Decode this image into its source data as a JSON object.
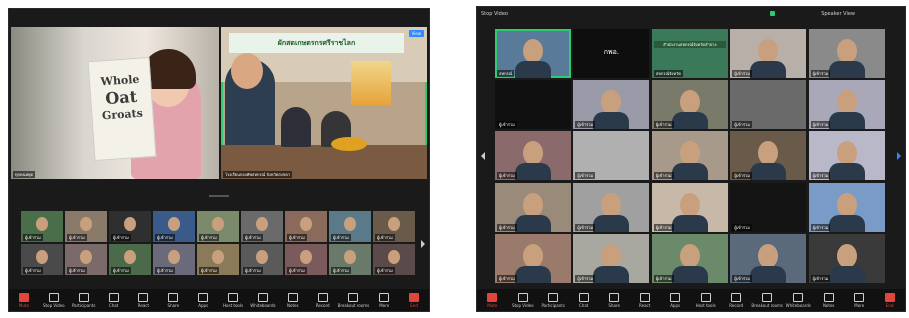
{
  "left_window": {
    "bag_text": [
      "Whole",
      "Oat",
      "Groats"
    ],
    "banner_text": "ผักสดเกษตรกรศรีราชไลก",
    "view_label": "View",
    "main_tiles": [
      {
        "name": "ทุกคนหยุด"
      },
      {
        "name": "โรงเรียนกองทัพสหกรณ์ จังหวัดสงขลา"
      }
    ],
    "thumb_names": [
      "ผู้เข้าร่วม",
      "ผู้เข้าร่วม",
      "ผู้เข้าร่วม",
      "ผู้เข้าร่วม",
      "ผู้เข้าร่วม",
      "ผู้เข้าร่วม",
      "ผู้เข้าร่วม",
      "ผู้เข้าร่วม",
      "ผู้เข้าร่วม",
      "ผู้เข้าร่วม",
      "ผู้เข้าร่วม",
      "ผู้เข้าร่วม",
      "ผู้เข้าร่วม",
      "ผู้เข้าร่วม",
      "ผู้เข้าร่วม",
      "ผู้เข้าร่วม",
      "ผู้เข้าร่วม",
      "ผู้เข้าร่วม"
    ],
    "toolbar": [
      "Mute",
      "Stop Video",
      "Participants",
      "Chat",
      "React",
      "Share",
      "Apps",
      "Host tools",
      "Whiteboards",
      "Notes",
      "Record",
      "Breakout rooms",
      "More",
      "End"
    ]
  },
  "right_window": {
    "title": "Stop Video",
    "top_right": "Speaker View",
    "center_tile_text": "กพอ.",
    "banner_text": "สำนักงานสหกรณ์จังหวัดลำปาง",
    "tile_names": [
      "สหกรณ์",
      "",
      "สหกรณ์จังหวัด",
      "ผู้เข้าร่วม",
      "ผู้เข้าร่วม",
      "ผู้เข้าร่วม",
      "ผู้เข้าร่วม",
      "ผู้เข้าร่วม",
      "ผู้เข้าร่วม",
      "ผู้เข้าร่วม",
      "ผู้เข้าร่วม",
      "ผู้เข้าร่วม",
      "ผู้เข้าร่วม",
      "ผู้เข้าร่วม",
      "ผู้เข้าร่วม",
      "ผู้เข้าร่วม",
      "ผู้เข้าร่วม",
      "ผู้เข้าร่วม",
      "ผู้เข้าร่วม",
      "ผู้เข้าร่วม",
      "ผู้เข้าร่วม",
      "ผู้เข้าร่วม",
      "ผู้เข้าร่วม",
      "ผู้เข้าร่วม",
      "ผู้เข้าร่วม"
    ],
    "toolbar": [
      "Mute",
      "Stop Video",
      "Participants",
      "Chat",
      "Share",
      "React",
      "Apps",
      "Host tools",
      "Record",
      "Breakout rooms",
      "Whiteboards",
      "Notes",
      "More",
      "End"
    ]
  }
}
